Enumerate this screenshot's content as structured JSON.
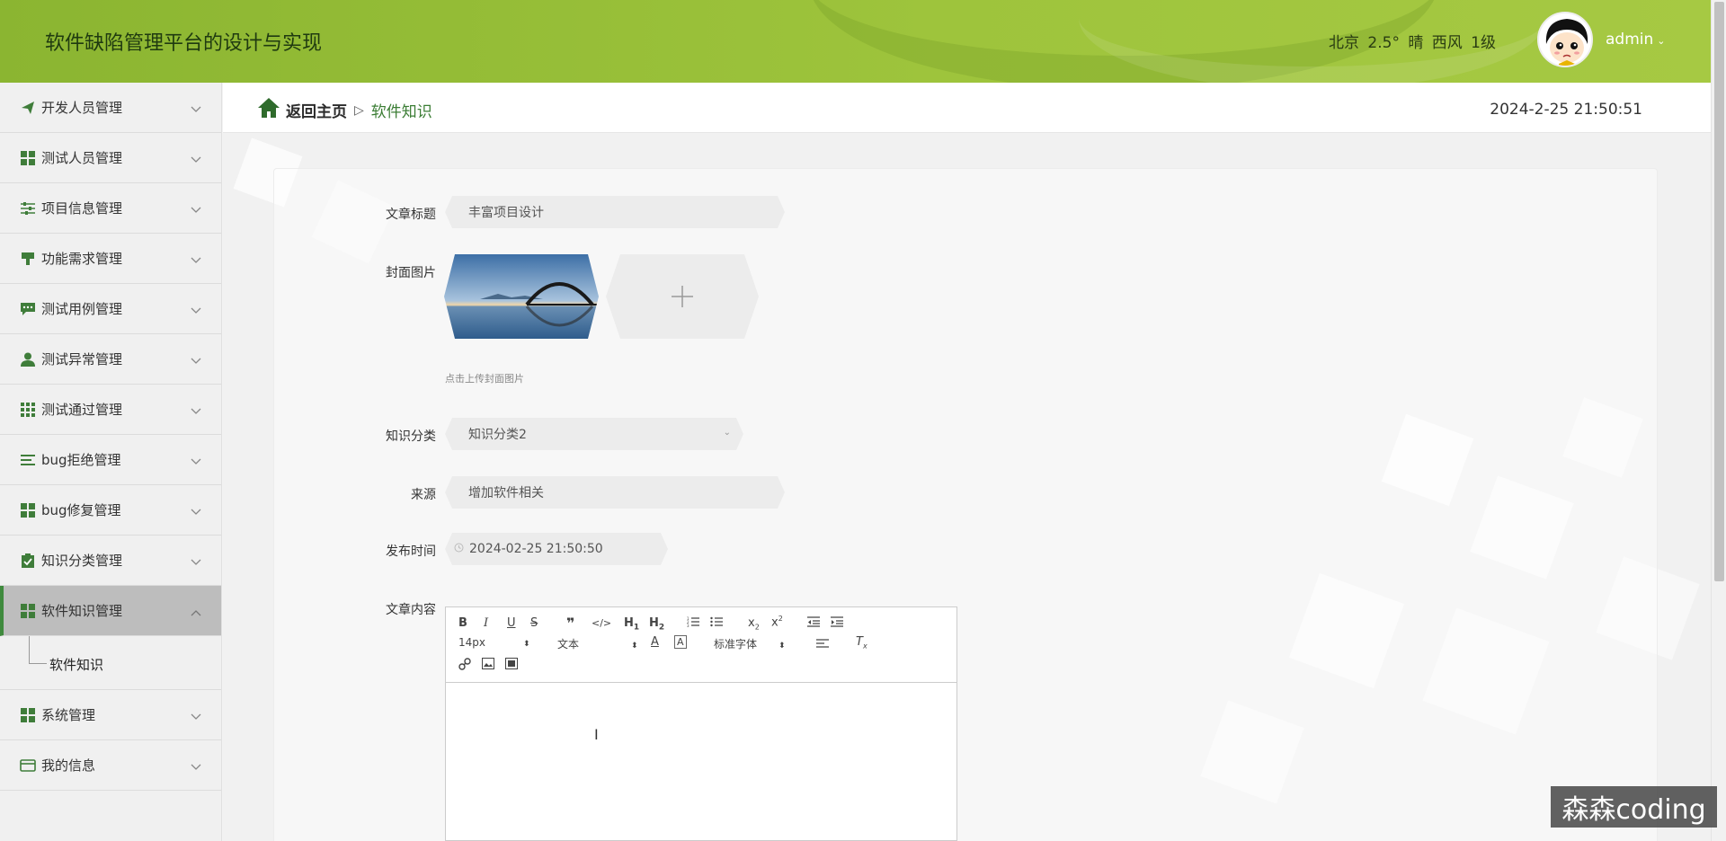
{
  "header": {
    "app_title": "软件缺陷管理平台的设计与实现",
    "weather": "北京  2.5°  晴  西风  1级",
    "username": "admin",
    "colors": {
      "header_bg": "#9ec43c",
      "accent": "#3f8a3d"
    }
  },
  "sidebar": {
    "items": [
      {
        "label": "开发人员管理",
        "icon": "paper-plane-icon"
      },
      {
        "label": "测试人员管理",
        "icon": "grid-icon"
      },
      {
        "label": "项目信息管理",
        "icon": "sliders-icon"
      },
      {
        "label": "功能需求管理",
        "icon": "paint-brush-icon"
      },
      {
        "label": "测试用例管理",
        "icon": "comment-icon"
      },
      {
        "label": "测试异常管理",
        "icon": "user-icon"
      },
      {
        "label": "测试通过管理",
        "icon": "grid-3x3-icon"
      },
      {
        "label": "bug拒绝管理",
        "icon": "list-icon"
      },
      {
        "label": "bug修复管理",
        "icon": "grid-icon"
      },
      {
        "label": "知识分类管理",
        "icon": "clipboard-check-icon"
      },
      {
        "label": "软件知识管理",
        "icon": "grid-icon"
      },
      {
        "label": "系统管理",
        "icon": "grid-icon"
      },
      {
        "label": "我的信息",
        "icon": "card-icon"
      }
    ],
    "active_submenu": "软件知识"
  },
  "breadcrumb": {
    "home": "返回主页",
    "separator": "▷",
    "current": "软件知识"
  },
  "datetime": "2024-2-25 21:50:51",
  "form": {
    "title_label": "文章标题",
    "title_value": "丰富项目设计",
    "cover_label": "封面图片",
    "cover_hint": "点击上传封面图片",
    "category_label": "知识分类",
    "category_value": "知识分类2",
    "source_label": "来源",
    "source_value": "增加软件相关",
    "publish_label": "发布时间",
    "publish_value": "2024-02-25 21:50:50",
    "content_label": "文章内容"
  },
  "editor": {
    "font_size": "14px",
    "text_type": "文本",
    "font_family": "标准字体"
  },
  "watermark": "森森coding"
}
